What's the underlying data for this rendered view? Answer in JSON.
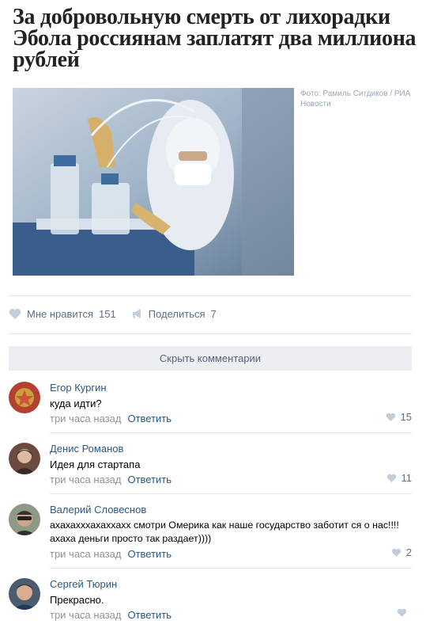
{
  "article": {
    "headline": "За добровольную смерть от лихорадки Эбола россиянам заплатят два миллиона рублей",
    "photo_credit": "Фото: Рамиль Ситдиков / РИА Новости"
  },
  "actions": {
    "like_label": "Мне нравится",
    "like_count": "151",
    "share_label": "Поделиться",
    "share_count": "7"
  },
  "comments_toggle": "Скрыть комментарии",
  "comments": [
    {
      "author": "Егор Кургин",
      "text": "куда идти?",
      "time": "три часа назад",
      "reply": "Ответить",
      "likes": "15"
    },
    {
      "author": "Денис Романов",
      "text": "Идея для стартапа",
      "time": "три часа назад",
      "reply": "Ответить",
      "likes": "11"
    },
    {
      "author": "Валерий Словеснов",
      "text": "ахахахххахаххахх смотри Омерика как наше государство заботит ся о нас!!!! ахаха деньги просто так раздает))))",
      "time": "три часа назад",
      "reply": "Ответить",
      "likes": "2"
    },
    {
      "author": "Сергей Тюрин",
      "text": "Прекрасно.",
      "time": "три часа назад",
      "reply": "Ответить",
      "likes": ""
    }
  ],
  "colors": {
    "link": "#2a5885",
    "muted": "#939393",
    "action": "#5d6f85",
    "icon": "#c3ceda"
  }
}
